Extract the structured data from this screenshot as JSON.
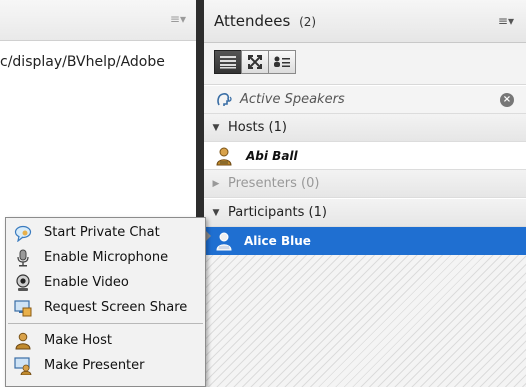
{
  "left_pod": {
    "url_text": "c/display/BVhelp/Adobe",
    "menu_glyph": "≡▾"
  },
  "attendees_pod": {
    "title": "Attendees",
    "count": "(2)",
    "menu_glyph": "≡▾",
    "active_speakers_label": "Active Speakers",
    "sections": {
      "hosts": "Hosts (1)",
      "presenters": "Presenters (0)",
      "participants": "Participants (1)"
    },
    "hosts": [
      {
        "name": "Abi Ball"
      }
    ],
    "participants": [
      {
        "name": "Alice Blue",
        "selected": true
      }
    ]
  },
  "context_menu": {
    "items": [
      {
        "label": "Start Private Chat",
        "icon": "chat-bubble-icon"
      },
      {
        "label": "Enable Microphone",
        "icon": "microphone-icon"
      },
      {
        "label": "Enable Video",
        "icon": "webcam-icon"
      },
      {
        "label": "Request Screen Share",
        "icon": "screen-share-icon"
      },
      {
        "label": "Make Host",
        "icon": "host-icon"
      },
      {
        "label": "Make Presenter",
        "icon": "presenter-icon"
      }
    ]
  },
  "colors": {
    "selection": "#1f6fd1",
    "divider": "#2d2d2d"
  }
}
